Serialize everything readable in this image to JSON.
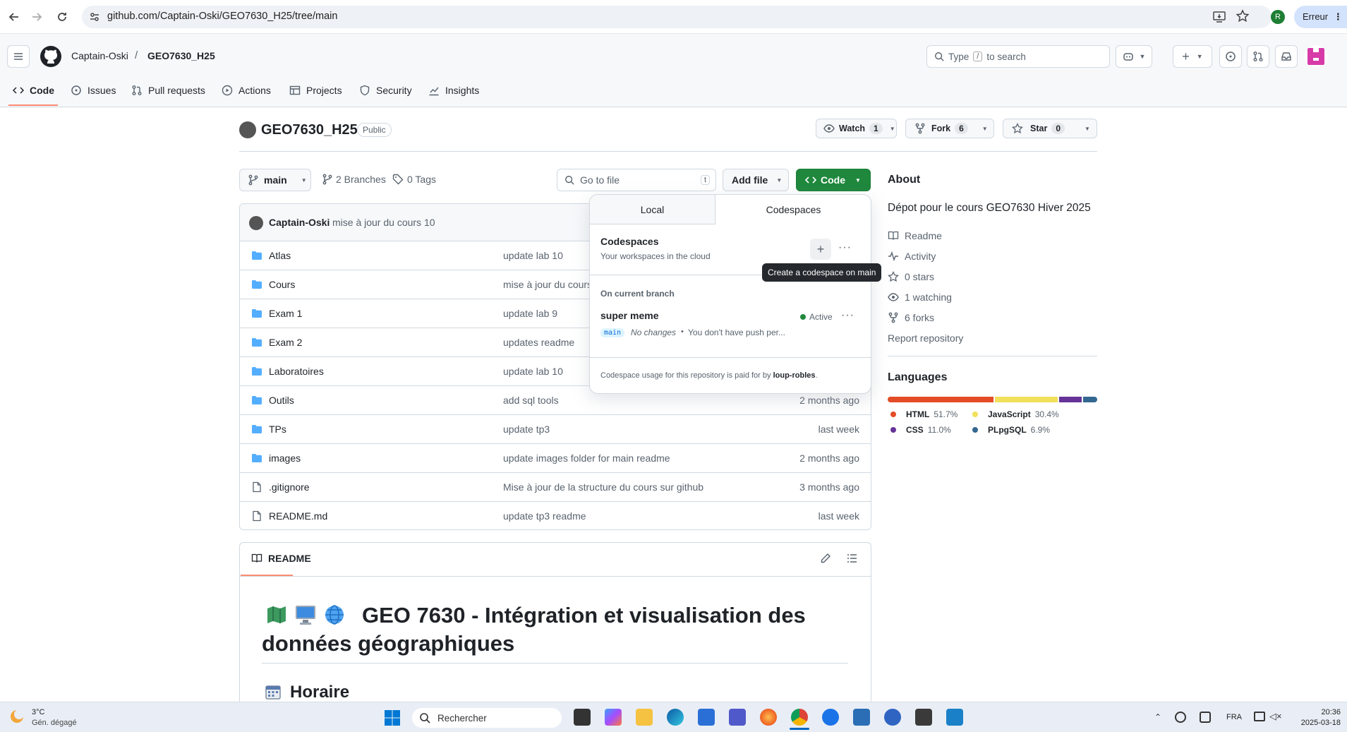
{
  "browser": {
    "url": "github.com/Captain-Oski/GEO7630_H25/tree/main",
    "status_chip": "Erreur",
    "profile_initial": "R"
  },
  "header": {
    "owner": "Captain-Oski",
    "separator": "/",
    "repo": "GEO7630_H25",
    "search_prefix": "Type",
    "search_key": "/",
    "search_suffix": "to search"
  },
  "nav": {
    "tabs": [
      "Code",
      "Issues",
      "Pull requests",
      "Actions",
      "Projects",
      "Security",
      "Insights"
    ]
  },
  "repo": {
    "name": "GEO7630_H25",
    "visibility": "Public",
    "watch_label": "Watch",
    "watch_count": "1",
    "fork_label": "Fork",
    "fork_count": "6",
    "star_label": "Star",
    "star_count": "0"
  },
  "toolbar": {
    "branch": "main",
    "branches": "2 Branches",
    "tags": "0 Tags",
    "go_to_file": "Go to file",
    "go_to_file_key": "t",
    "add_file": "Add file",
    "code": "Code"
  },
  "commit": {
    "author": "Captain-Oski",
    "message": "mise à jour du cours 10"
  },
  "files": [
    {
      "name": "Atlas",
      "type": "folder",
      "message": "update lab 10",
      "date": ""
    },
    {
      "name": "Cours",
      "type": "folder",
      "message": "mise à jour du cours",
      "date": ""
    },
    {
      "name": "Exam 1",
      "type": "folder",
      "message": "update lab 9",
      "date": ""
    },
    {
      "name": "Exam 2",
      "type": "folder",
      "message": "updates readme",
      "date": ""
    },
    {
      "name": "Laboratoires",
      "type": "folder",
      "message": "update lab 10",
      "date": ""
    },
    {
      "name": "Outils",
      "type": "folder",
      "message": "add sql tools",
      "date": "2 months ago"
    },
    {
      "name": "TPs",
      "type": "folder",
      "message": "update tp3",
      "date": "last week"
    },
    {
      "name": "images",
      "type": "folder",
      "message": "update images folder for main readme",
      "date": "2 months ago"
    },
    {
      "name": ".gitignore",
      "type": "file",
      "message": "Mise à jour de la structure du cours sur github",
      "date": "3 months ago"
    },
    {
      "name": "README.md",
      "type": "file",
      "message": "update tp3 readme",
      "date": "last week"
    }
  ],
  "readme": {
    "tab": "README",
    "title": "GEO 7630 - Intégration et visualisation des données géographiques",
    "subtitle": "Horaire"
  },
  "codespaces_popup": {
    "tab_local": "Local",
    "tab_codespaces": "Codespaces",
    "title": "Codespaces",
    "subtitle": "Your workspaces in the cloud",
    "tooltip": "Create a codespace on main",
    "section": "On current branch",
    "codespace_name": "super meme",
    "status": "Active",
    "branch": "main",
    "changes": "No changes",
    "bullet": "•",
    "push_note": "You don't have push per...",
    "footer_prefix": "Codespace usage for this repository is paid for by",
    "footer_owner": "loup-robles",
    "footer_suffix": "."
  },
  "about": {
    "heading": "About",
    "description": "Dépot pour le cours GEO7630 Hiver 2025",
    "readme": "Readme",
    "activity": "Activity",
    "stars": "0 stars",
    "watching": "1 watching",
    "forks": "6 forks",
    "report": "Report repository"
  },
  "languages": {
    "heading": "Languages",
    "items": [
      {
        "name": "HTML",
        "percent": "51.7%",
        "color": "#e34c26",
        "value": 51.7
      },
      {
        "name": "JavaScript",
        "percent": "30.4%",
        "color": "#f1e05a",
        "value": 30.4
      },
      {
        "name": "CSS",
        "percent": "11.0%",
        "color": "#663399",
        "value": 11.0
      },
      {
        "name": "PLpgSQL",
        "percent": "6.9%",
        "color": "#336790",
        "value": 6.9
      }
    ]
  },
  "taskbar": {
    "weather_temp": "3°C",
    "weather_desc": "Gén. dégagé",
    "search": "Rechercher",
    "lang": "FRA",
    "time": "20:36",
    "date": "2025-03-18"
  }
}
